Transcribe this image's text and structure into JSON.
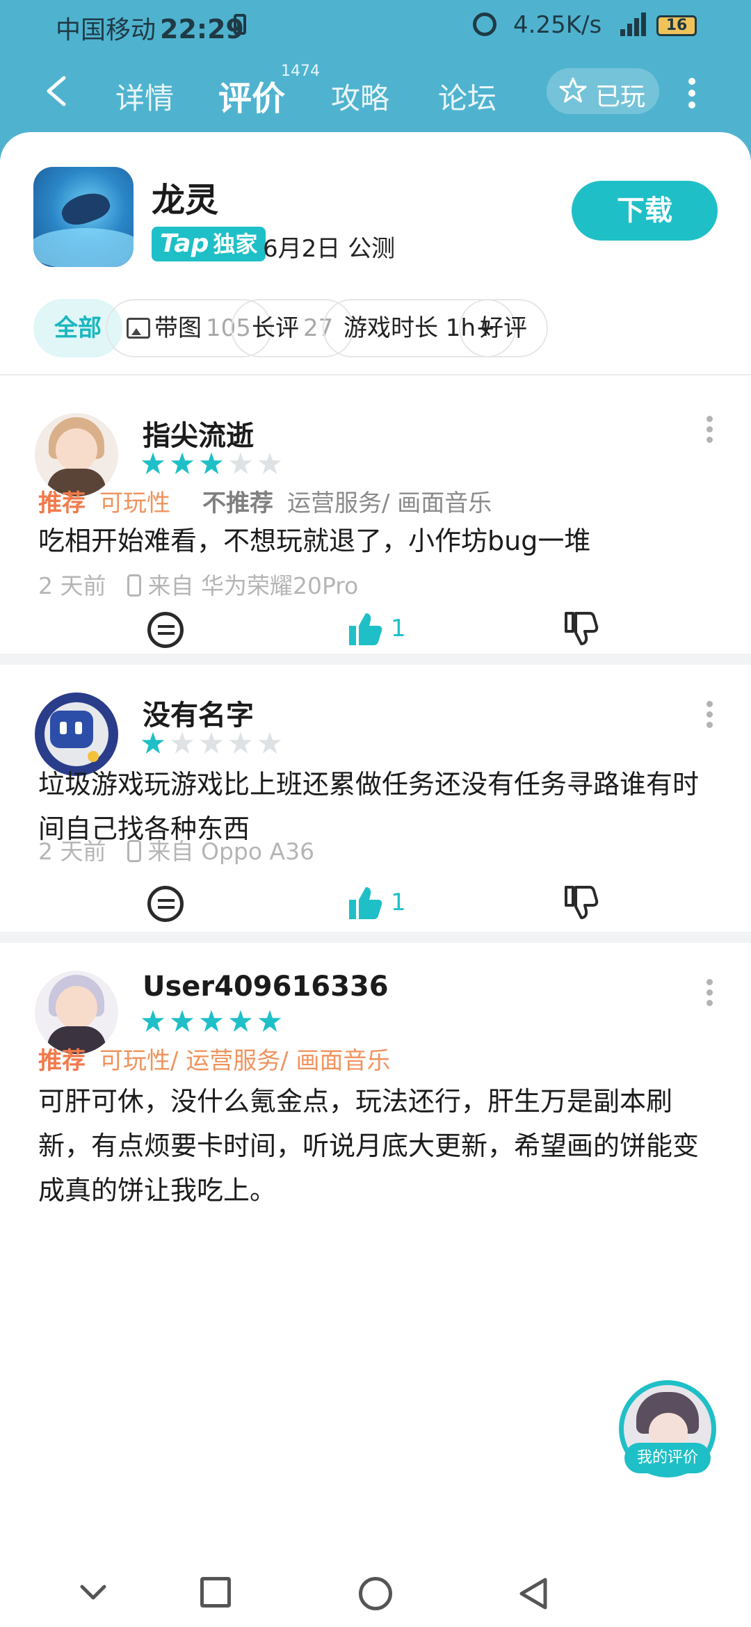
{
  "status_bar": {
    "carrier": "中国移动",
    "time": "22:29",
    "net_speed": "4.25K/s",
    "battery": "16"
  },
  "nav": {
    "tabs": [
      "详情",
      "评价",
      "攻略",
      "论坛"
    ],
    "active_tab": "评价",
    "review_count": "1474",
    "played_label": "已玩"
  },
  "game": {
    "name": "龙灵",
    "tap_badge_brand": "Tap",
    "tap_badge_text": "独家",
    "release": "6月2日 公测",
    "download_label": "下载"
  },
  "filters": [
    {
      "label": "全部",
      "count": ""
    },
    {
      "label": "带图",
      "count": "105"
    },
    {
      "label": "长评",
      "count": "27"
    },
    {
      "label": "游戏时长 1h+",
      "count": ""
    },
    {
      "label": "好评",
      "count": ""
    }
  ],
  "reviews": [
    {
      "user": "指尖流逝",
      "rating": 3,
      "recommend_label": "推荐",
      "recommend_items": "可玩性",
      "not_recommend_label": "不推荐",
      "not_recommend_items": "运营服务/ 画面音乐",
      "content": "吃相开始难看，不想玩就退了，小作坊bug一堆",
      "time": "2 天前",
      "device": "来自 华为荣耀20Pro",
      "likes": "1"
    },
    {
      "user": "没有名字",
      "rating": 1,
      "content": "垃圾游戏玩游戏比上班还累做任务还没有任务寻路谁有时间自己找各种东西",
      "time": "2 天前",
      "device": "来自 Oppo A36",
      "likes": "1"
    },
    {
      "user": "User409616336",
      "rating": 5,
      "recommend_label": "推荐",
      "recommend_items": "可玩性/ 运营服务/ 画面音乐",
      "content": "可肝可休，没什么氪金点，玩法还行，肝生万是副本刷新，有点烦要卡时间，听说月底大更新，希望画的饼能变成真的饼让我吃上。"
    }
  ],
  "my_review_label": "我的评价",
  "colors": {
    "header": "#4fb3cf",
    "accent": "#1fbfc7",
    "recommend": "#f07a4b"
  }
}
